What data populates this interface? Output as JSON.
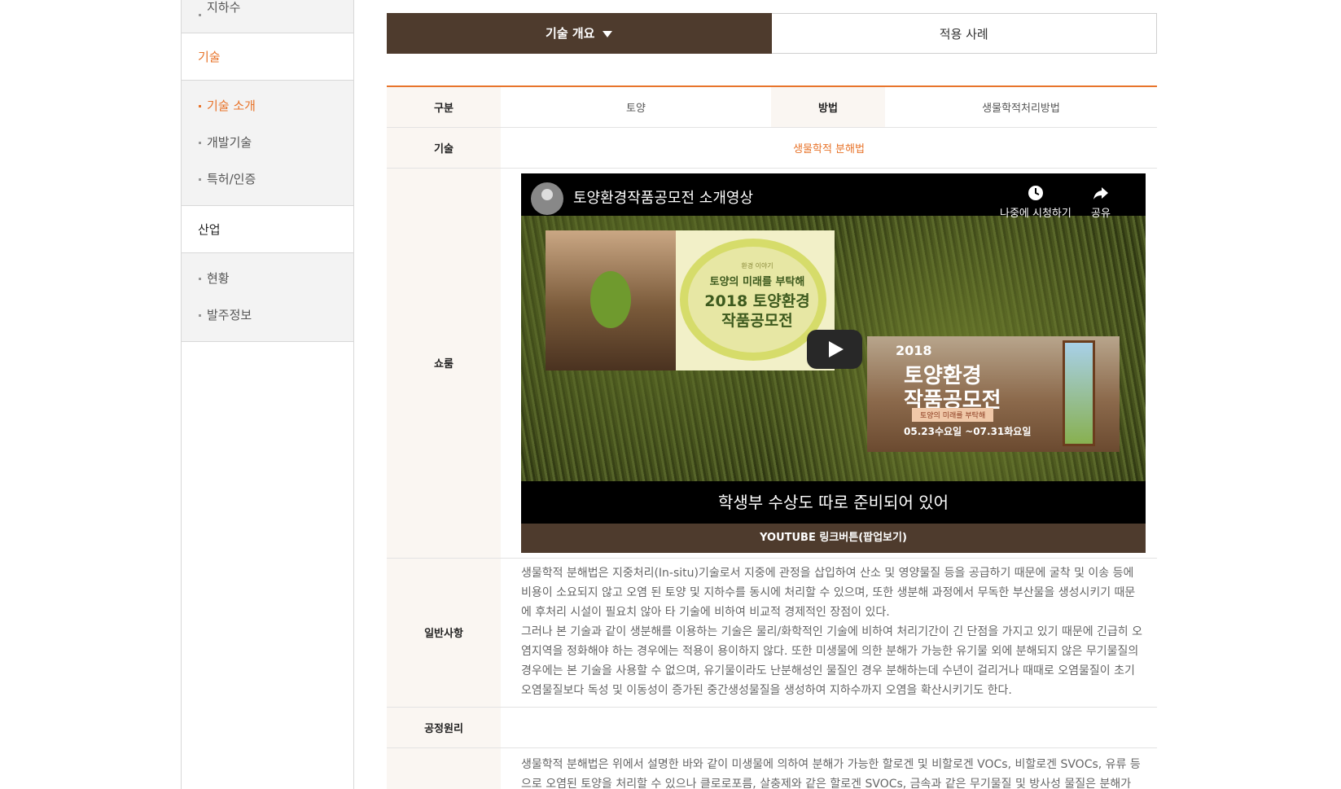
{
  "sidebar": {
    "groups": [
      {
        "items": [
          {
            "label": "지하수"
          }
        ]
      },
      {
        "head": "기술",
        "items": [
          {
            "label": "기술 소개"
          },
          {
            "label": "개발기술"
          },
          {
            "label": "특허/인증"
          }
        ]
      },
      {
        "head": "산업",
        "items": [
          {
            "label": "현황"
          },
          {
            "label": "발주정보"
          }
        ]
      }
    ]
  },
  "tabs": {
    "overview": "기술 개요",
    "cases": "적용 사례"
  },
  "table": {
    "category_label": "구분",
    "category_value": "토양",
    "method_label": "방법",
    "method_value": "생물학적처리방법",
    "tech_label": "기술",
    "tech_value": "생물학적 분해법",
    "showroom_label": "쇼룸",
    "general_label": "일반사항",
    "general_p1": "생물학적 분해법은 지중처리(In-situ)기술로서 지중에 관정을 삽입하여 산소 및 영양물질 등을 공급하기 때문에 굴착 및 이송 등에 비용이 소요되지 않고 오염 된 토양 및 지하수를 동시에 처리할 수 있으며, 또한 생분해 과정에서 무독한 부산물을 생성시키기 때문에 후처리 시설이 필요치 않아 타 기술에 비하여 비교적 경제적인 장점이 있다.",
    "general_p2": "그러나 본 기술과 같이 생분해를 이용하는 기술은 물리/화학적인 기술에 비하여 처리기간이 긴 단점을 가지고 있기 때문에 긴급히 오염지역을 정화해야 하는 경우에는 적용이 용이하지 않다. 또한 미생물에 의한 분해가 가능한 유기물 외에 분해되지 않은 무기물질의 경우에는 본 기술을 사용할 수 없으며, 유기물이라도 난분해성인 물질인 경우 분해하는데 수년이 걸리거나 때때로 오염물질이 초기 오염물질보다 독성 및 이동성이 증가된 중간생성물질을 생성하여 지하수까지 오염을 확산시키기도 한다.",
    "process_label": "공정원리",
    "process_text": "생물학적 분해법은 위에서 설명한 바와 같이 미생물에 의하여 분해가 가능한 할로겐 및 비할로겐 VOCs, 비할로겐 SVOCs, 유류 등으로 오염된 토양을 처리할 수 있으나 클로로포름, 살충제와 같은 할로겐 SVOCs, 금속과 같은 무기물질 및 방사성 물질은 분해가 전혀"
  },
  "video": {
    "title": "토양환경작품공모전 소개영상",
    "watch_later": "나중에 시청하기",
    "share": "공유",
    "thumb1_small": "환경 이야기",
    "thumb1_sub": "토양의 미래를 부탁해",
    "thumb1_title1": "2018 토양환경",
    "thumb1_title2": "작품공모전",
    "thumb2_year": "2018",
    "thumb2_title1": "토양환경",
    "thumb2_title2": "작품공모전",
    "thumb2_badge": "토양의 미래를 부탁해",
    "thumb2_dates": "05.23수요일 ~07.31화요일",
    "subtitle": "학생부 수상도 따로 준비되어 있어",
    "youtube_button": "YOUTUBE 링크버튼(팝업보기)"
  },
  "colors": {
    "accent": "#e8742b",
    "brown": "#4e3b2d"
  }
}
